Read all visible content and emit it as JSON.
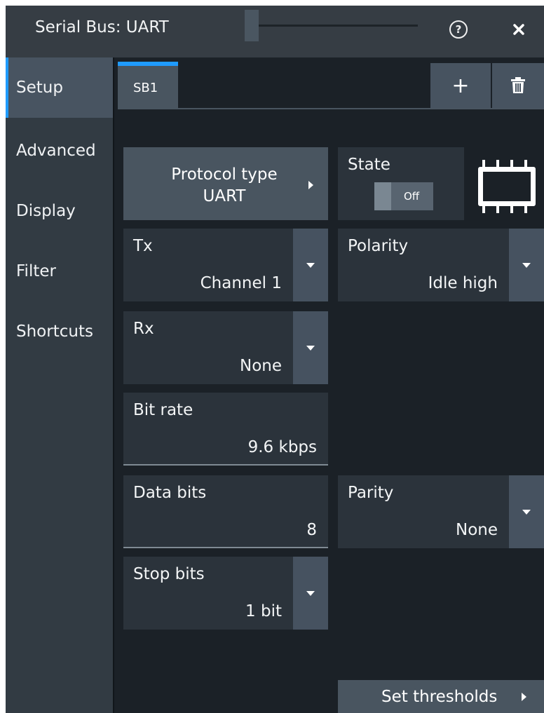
{
  "window": {
    "title": "Serial Bus: UART",
    "help_icon": "question-mark-circle",
    "close_icon": "close-x",
    "close_glyph": "✕"
  },
  "sidebar": {
    "items": [
      {
        "label": "Setup",
        "selected": true
      },
      {
        "label": "Advanced"
      },
      {
        "label": "Display"
      },
      {
        "label": "Filter"
      },
      {
        "label": "Shortcuts"
      }
    ]
  },
  "tabs": {
    "items": [
      {
        "label": "SB1",
        "selected": true
      }
    ],
    "add_glyph": "+",
    "delete_icon": "trash"
  },
  "setup": {
    "protocol_type": {
      "label": "Protocol type",
      "value": "UART"
    },
    "state": {
      "label": "State",
      "value": "Off"
    },
    "tx": {
      "label": "Tx",
      "value": "Channel 1"
    },
    "polarity": {
      "label": "Polarity",
      "value": "Idle high"
    },
    "rx": {
      "label": "Rx",
      "value": "None"
    },
    "bit_rate": {
      "label": "Bit rate",
      "value": "9.6 kbps"
    },
    "data_bits": {
      "label": "Data bits",
      "value": "8"
    },
    "parity": {
      "label": "Parity",
      "value": "None"
    },
    "stop_bits": {
      "label": "Stop bits",
      "value": "1 bit"
    },
    "set_thresholds": {
      "label": "Set thresholds"
    }
  },
  "colors": {
    "accent": "#1f9bff",
    "background": "#1b2127",
    "panel": "#2b333b",
    "button": "#495560"
  }
}
